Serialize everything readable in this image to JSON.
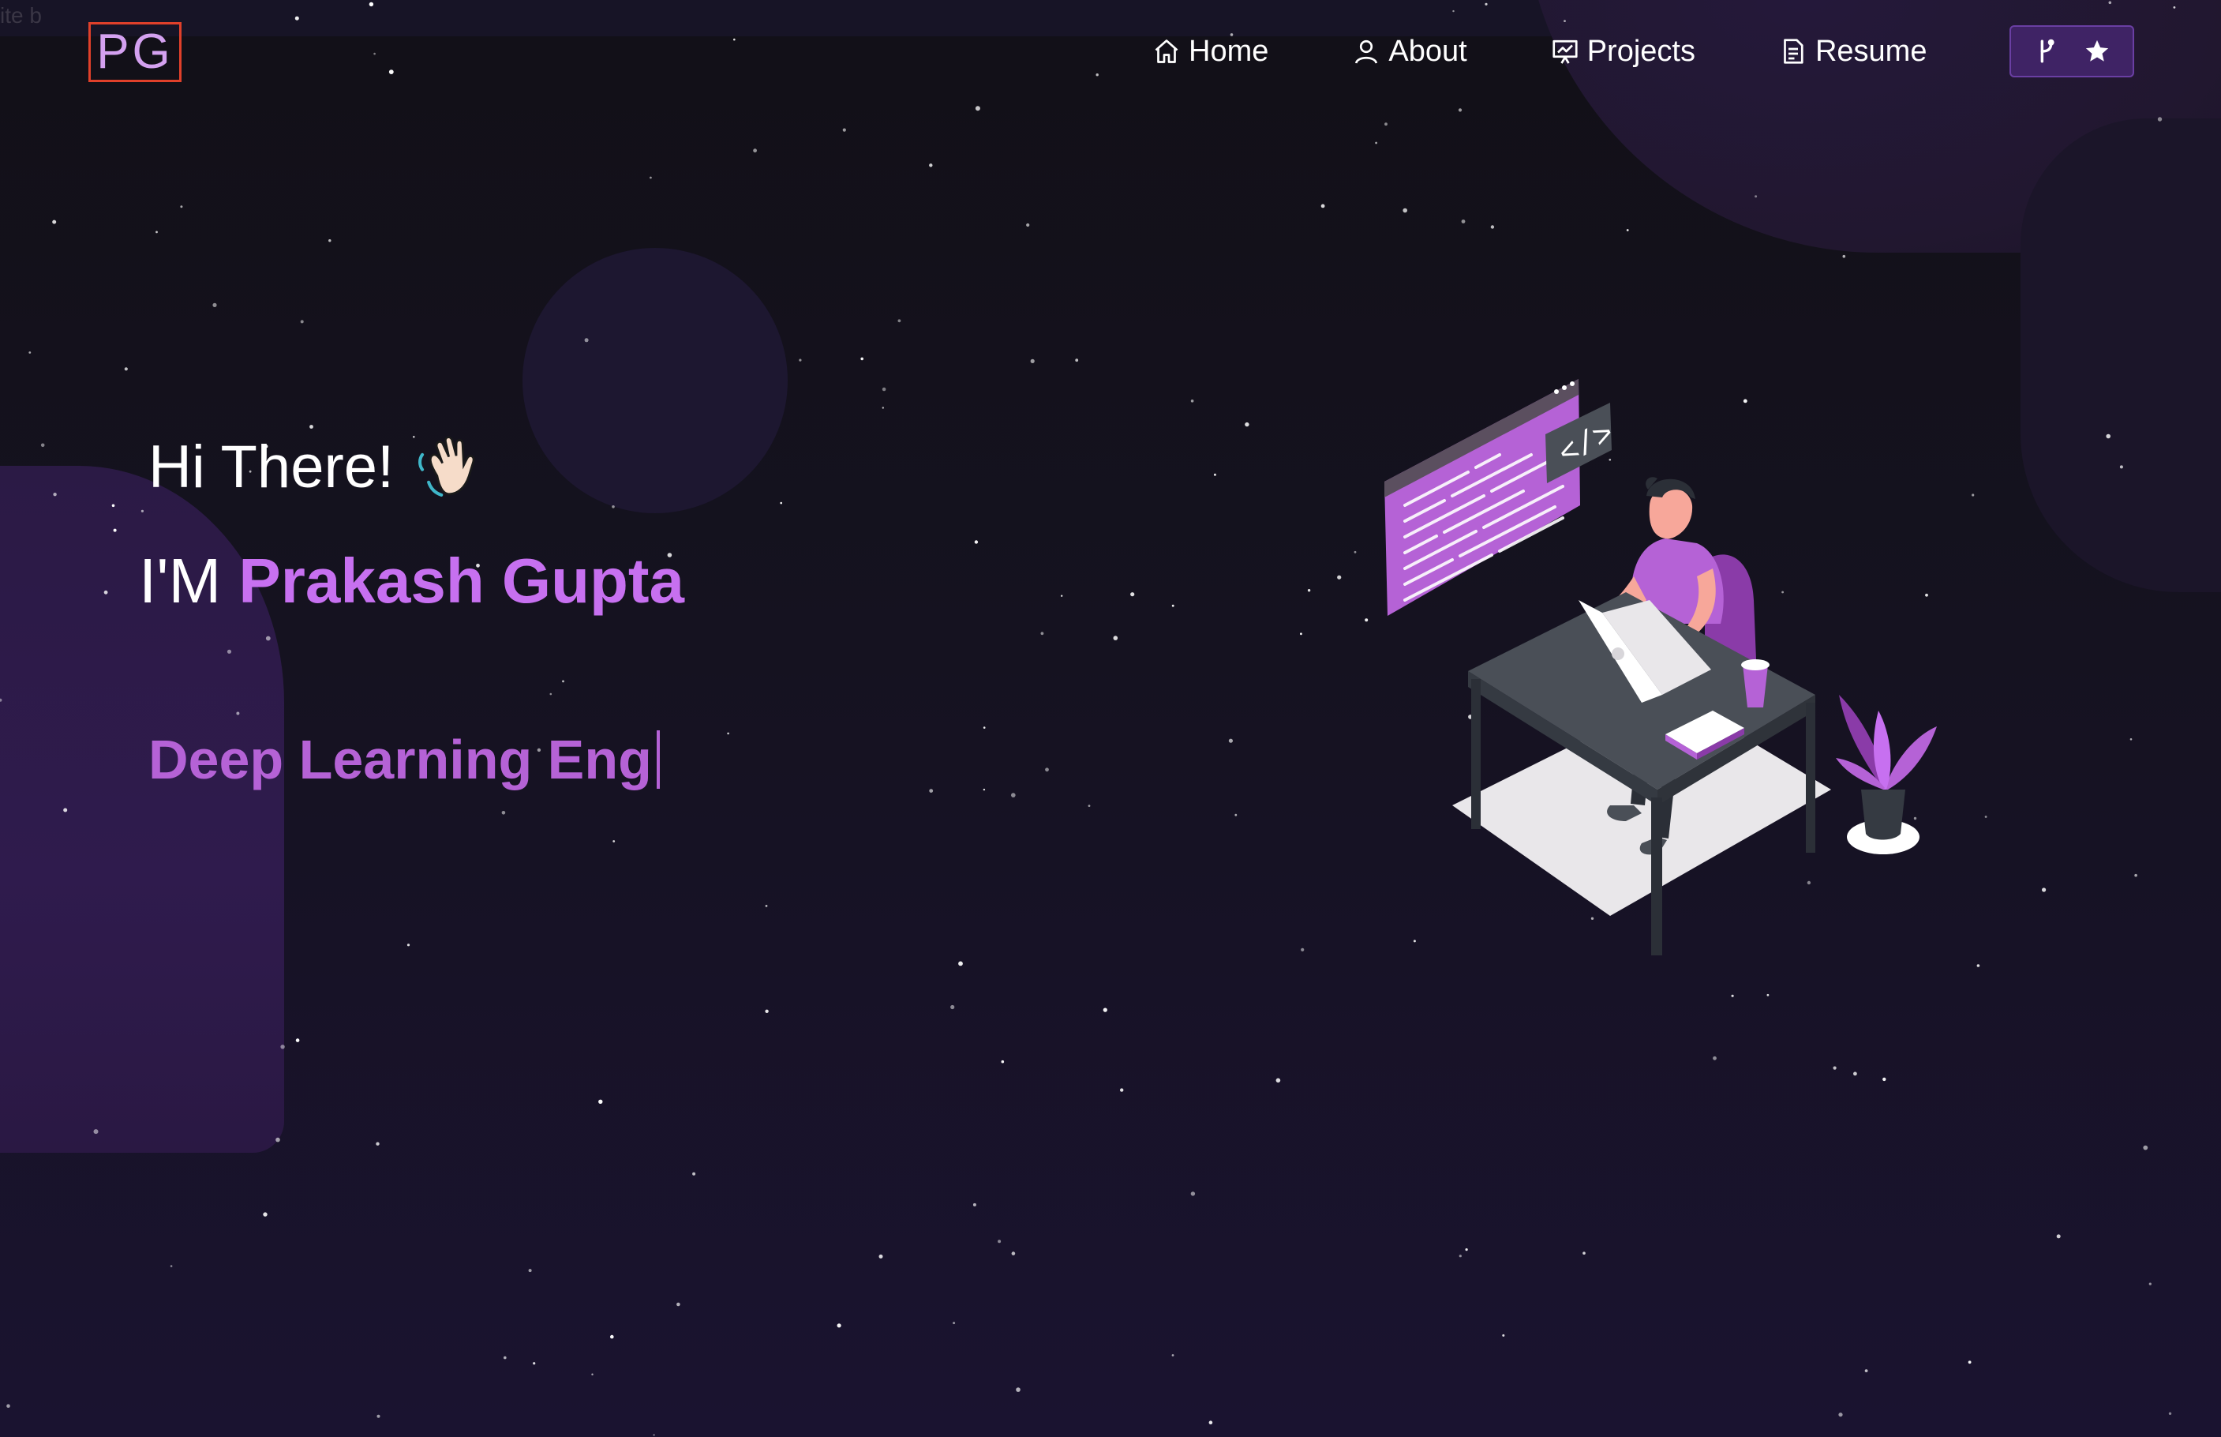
{
  "ghost_text": "ite b",
  "logo": {
    "text": "PG"
  },
  "nav": {
    "items": [
      {
        "label": "Home",
        "icon": "home-icon"
      },
      {
        "label": "About",
        "icon": "user-icon"
      },
      {
        "label": "Projects",
        "icon": "presentation-icon"
      },
      {
        "label": "Resume",
        "icon": "document-icon"
      }
    ],
    "github_button": {
      "icons": [
        "git-fork-icon",
        "star-icon"
      ]
    }
  },
  "hero": {
    "greeting": "Hi There!",
    "greeting_emoji": "waving-hand-icon",
    "intro_prefix": "I'M",
    "name": "Prakash Gupta",
    "typed_text": "Deep Learning Eng"
  },
  "colors": {
    "accent": "#c770f0",
    "typed": "#b562d6",
    "logo_border": "#e0402a",
    "button_bg": "#3f2365",
    "background": "#14111e"
  }
}
